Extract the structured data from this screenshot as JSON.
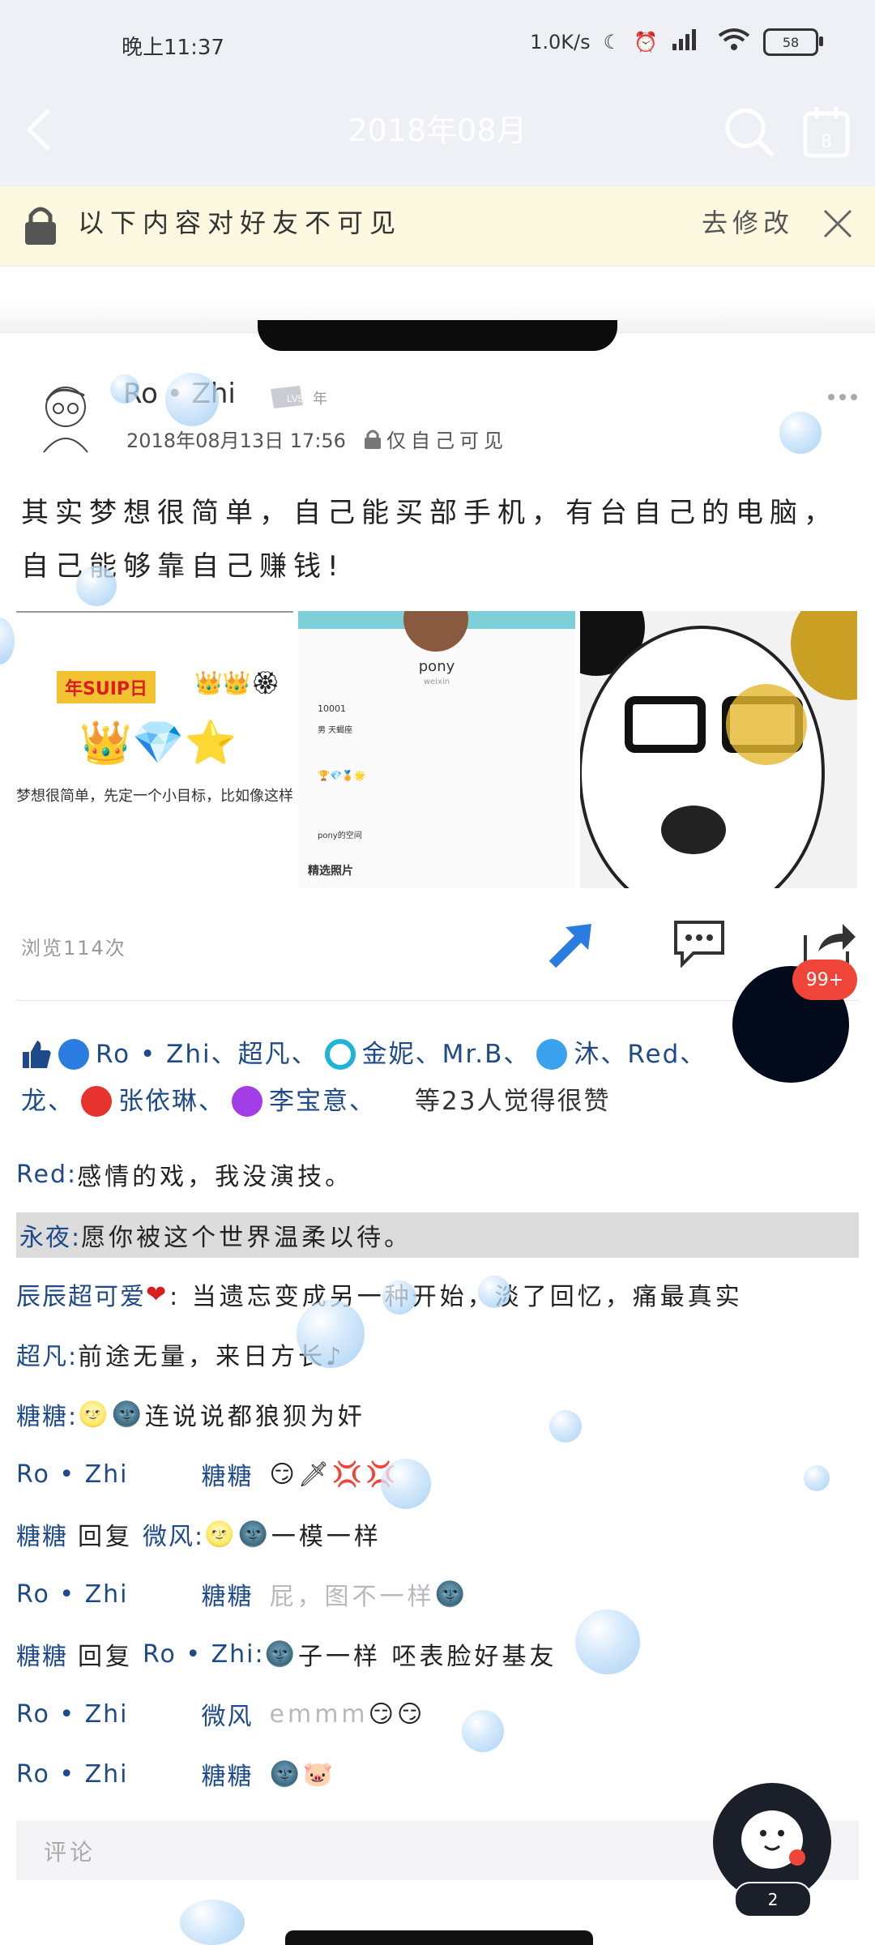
{
  "status_bar": {
    "time": "晚上11:37",
    "net_speed": "1.0K/s",
    "battery": "58"
  },
  "nav": {
    "title": "2018年08月"
  },
  "notice": {
    "text": "以下内容对好友不可见",
    "action": "去修改"
  },
  "post": {
    "author": "Ro • Zhi",
    "level_badge": "LV5",
    "level_suffix": "年",
    "datetime": "2018年08月13日 17:56",
    "privacy": "仅自己可见",
    "text": "其实梦想很简单，自己能买部手机，有台自己的电脑，自己能够靠自己赚钱!",
    "image1": {
      "header": "年SUIP日",
      "caption": "梦想很简单，先定一个小目标，比如像这样"
    },
    "image2": {
      "name": "pony",
      "sub": "weixin",
      "id": "10001",
      "gender": "男 天蝎座",
      "space": "pony的空间",
      "photos": "精选照片"
    },
    "views": "浏览114次"
  },
  "badge_count": "99+",
  "likes": {
    "row1": [
      "Ro • Zhi、超凡、",
      "金妮、Mr.B、",
      "沐、Red、"
    ],
    "row2_start": "龙、",
    "row2_names": [
      "张依琳、",
      "李宝意、"
    ],
    "row2_end": "等23人觉得很赞"
  },
  "comments": [
    {
      "name": "Red:",
      "text": "感情的戏，我没演技。"
    },
    {
      "name": "永夜:",
      "text": "愿你被这个世界温柔以待。"
    },
    {
      "name": "辰辰超可爱",
      "text": ": 当遗忘变成另一种开始，淡了回忆，痛最真实"
    },
    {
      "name": "超凡:",
      "text": "前途无量，来日方长♪"
    },
    {
      "name": "糖糖:",
      "text": "连说说都狼狈为奸"
    },
    {
      "name": "Ro • Zhi",
      "to": "糖糖",
      "text": ""
    },
    {
      "name": "糖糖",
      "reply": "回复",
      "to": "微风:",
      "text": "一模一样"
    },
    {
      "name": "Ro • Zhi",
      "to": "糖糖",
      "text": "屁，图不一样"
    },
    {
      "name": "糖糖",
      "reply": "回复",
      "to": "Ro • Zhi:",
      "text": "子一样 呸表脸好基友"
    },
    {
      "name": "Ro • Zhi",
      "to": "微风",
      "text": "emmm"
    },
    {
      "name": "Ro • Zhi",
      "to": "糖糖",
      "text": ""
    }
  ],
  "comment_input": {
    "placeholder": "评论"
  },
  "fab_count": "2",
  "colors": {
    "link": "#1e4a8a",
    "notice_bg": "#fdf8e0",
    "badge_red": "#f0463a",
    "share_blue": "#2a7ce0"
  }
}
